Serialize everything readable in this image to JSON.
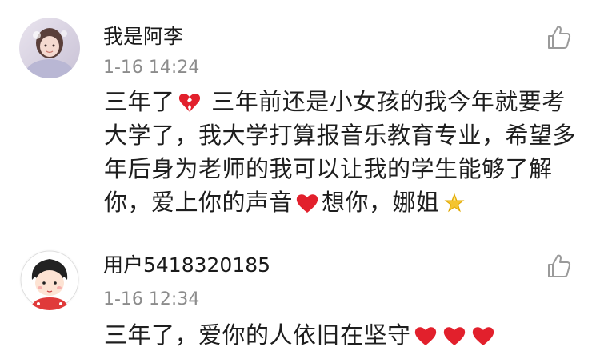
{
  "comments": [
    {
      "username": "我是阿李",
      "time": "1-16 14:24",
      "text_a": "三年了",
      "text_b": " 三年前还是小女孩的我今年就要考大学了，我大学打算报音乐教育专业，希望多年后身为老师的我可以让我的学生能够了解你，爱上你的声音",
      "text_c": "想你，娜姐",
      "emojis": [
        "broken-heart-icon",
        "red-heart-icon",
        "sparkle-star-icon"
      ]
    },
    {
      "username": "用户5418320185",
      "time": "1-16 12:34",
      "text_a": "三年了，爱你的人依旧在坚守",
      "emojis": [
        "red-heart-icon",
        "red-heart-icon",
        "red-heart-icon"
      ]
    }
  ],
  "colors": {
    "username": "#1a1a1a",
    "timestamp": "#8c8c8c",
    "body": "#1e1e1e",
    "divider": "#e3e3e3",
    "heart": "#e2202c"
  },
  "icons": {
    "like": "thumbs-up-outline-icon"
  }
}
